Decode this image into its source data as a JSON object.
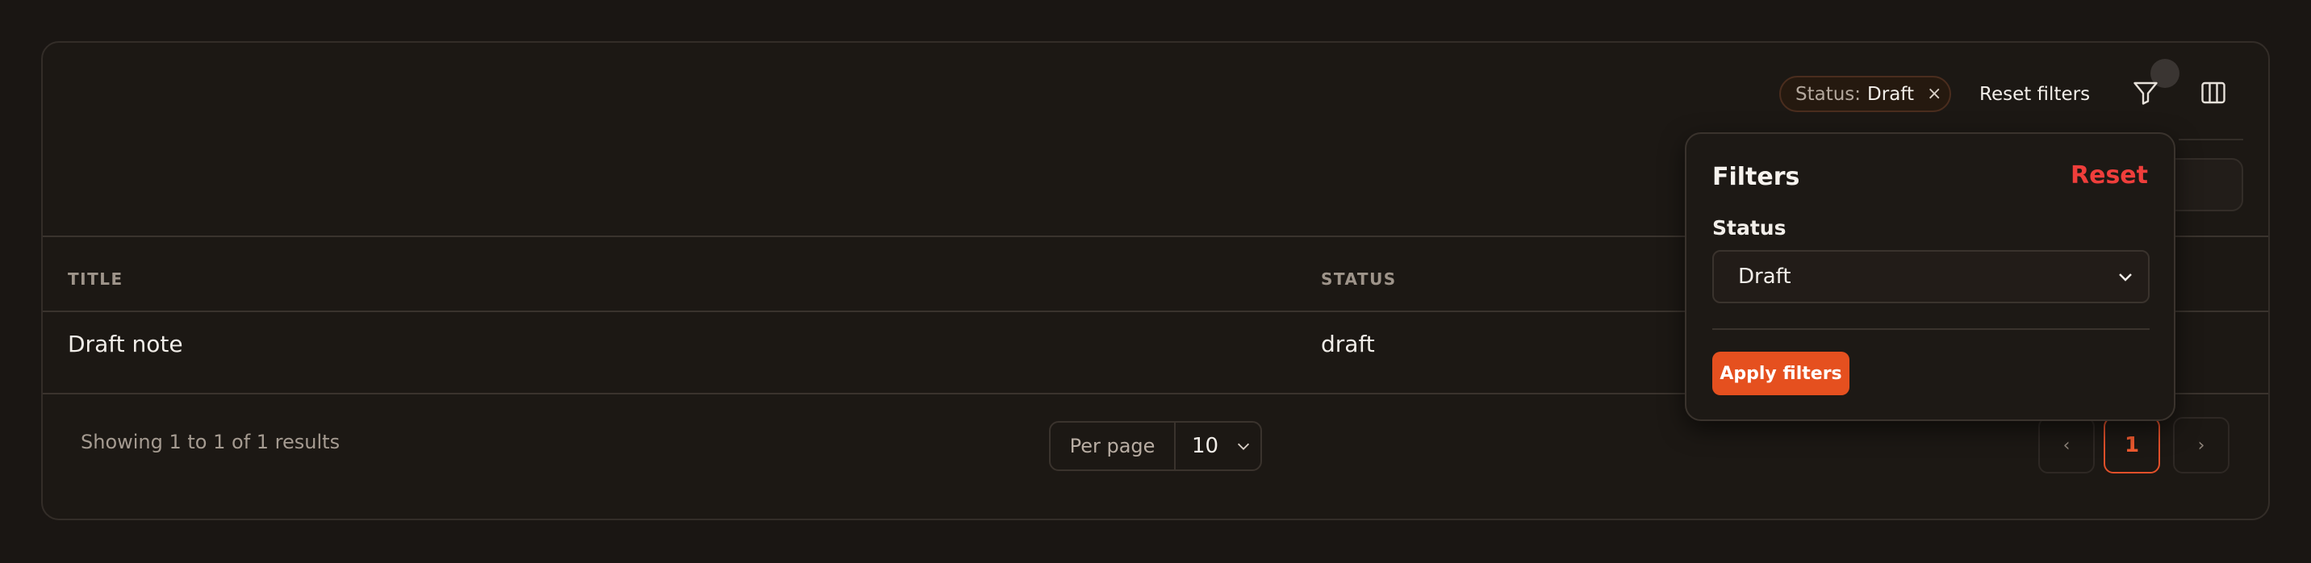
{
  "toolbar": {
    "active_filter": {
      "key": "Status:",
      "value": "Draft",
      "remove_glyph": "×"
    },
    "reset_filters_label": "Reset filters",
    "filter_icon": "funnel-icon",
    "columns_icon": "columns-icon"
  },
  "table": {
    "columns": [
      "TITLE",
      "STATUS"
    ],
    "rows": [
      {
        "title": "Draft note",
        "status": "draft"
      }
    ]
  },
  "footer": {
    "showing_text": "Showing 1 to 1 of 1 results",
    "per_page_label": "Per page",
    "per_page_value": "10",
    "pagination": {
      "prev": "‹",
      "current": "1",
      "next": "›"
    }
  },
  "filters_popover": {
    "title": "Filters",
    "reset_label": "Reset",
    "status_label": "Status",
    "status_selected": "Draft",
    "apply_label": "Apply filters"
  },
  "colors": {
    "accent": "#e5501f",
    "danger": "#ef3e3b",
    "background": "#1c1814"
  }
}
